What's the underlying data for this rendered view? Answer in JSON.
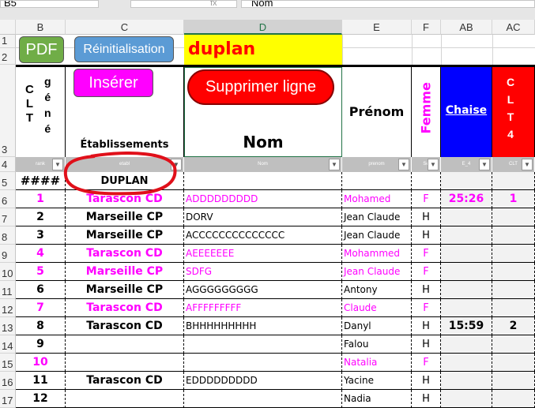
{
  "formula_bar": {
    "name_box": "B5",
    "fx": "fx",
    "formula": "Nom"
  },
  "columns": [
    "B",
    "C",
    "D",
    "E",
    "F",
    "AB",
    "AC"
  ],
  "row_numbers": [
    "1",
    "2",
    "3",
    "4",
    "5",
    "6",
    "7",
    "8",
    "9",
    "10",
    "11",
    "12",
    "13",
    "14",
    "15",
    "16",
    "17"
  ],
  "buttons": {
    "pdf": "PDF",
    "reset": "Réinitialisation",
    "insert": "Insérer",
    "delete": "Supprimer ligne"
  },
  "title_cell": "duplan",
  "headers": {
    "clt": [
      "C",
      "L",
      "T"
    ],
    "gene": [
      "g",
      "é",
      "n",
      "é"
    ],
    "etab": "Établissements",
    "nom": "Nom",
    "prenom": "Prénom",
    "femme": "Femme",
    "chaise": "Chaise",
    "clt4": [
      "C",
      "L",
      "T",
      "4"
    ]
  },
  "filters": [
    "rank",
    "etabl",
    "Nom",
    "prenom",
    "Se",
    "E_4",
    "CLT"
  ],
  "row5": {
    "rank": "####",
    "etab": "DUPLAN"
  },
  "colors": {
    "magenta": "#ff00ff",
    "blue": "#0000ff",
    "red": "#ff0000",
    "yellow": "#ffff00",
    "green": "#70ad47",
    "lightblue": "#5b9bd5"
  },
  "rows": [
    {
      "rank": "1",
      "etab": "Tarascon CD",
      "nom": "ADDDDDDDDD",
      "prenom": "Mohamed",
      "sexe": "F",
      "chaise": "25:26",
      "clt": "1",
      "f": true
    },
    {
      "rank": "2",
      "etab": "Marseille CP",
      "nom": "DORV",
      "prenom": "Jean Claude",
      "sexe": "H",
      "chaise": "",
      "clt": "",
      "f": false
    },
    {
      "rank": "3",
      "etab": "Marseille CP",
      "nom": "ACCCCCCCCCCCCCC",
      "prenom": "Jean Claude",
      "sexe": "H",
      "chaise": "",
      "clt": "",
      "f": false
    },
    {
      "rank": "4",
      "etab": "Tarascon CD",
      "nom": "AEEEEEEE",
      "prenom": "Mohammed",
      "sexe": "F",
      "chaise": "",
      "clt": "",
      "f": true
    },
    {
      "rank": "5",
      "etab": "Marseille CP",
      "nom": "SDFG",
      "prenom": "Jean Claude",
      "sexe": "F",
      "chaise": "",
      "clt": "",
      "f": true
    },
    {
      "rank": "6",
      "etab": "Marseille CP",
      "nom": "AGGGGGGGGG",
      "prenom": "Antony",
      "sexe": "H",
      "chaise": "",
      "clt": "",
      "f": false
    },
    {
      "rank": "7",
      "etab": "Tarascon CD",
      "nom": "AFFFFFFFFF",
      "prenom": "Claude",
      "sexe": "F",
      "chaise": "",
      "clt": "",
      "f": true
    },
    {
      "rank": "8",
      "etab": "Tarascon CD",
      "nom": "BHHHHHHHHH",
      "prenom": "Danyl",
      "sexe": "H",
      "chaise": "15:59",
      "clt": "2",
      "f": false
    },
    {
      "rank": "9",
      "etab": "",
      "nom": "",
      "prenom": "Falou",
      "sexe": "H",
      "chaise": "",
      "clt": "",
      "f": false
    },
    {
      "rank": "10",
      "etab": "",
      "nom": "",
      "prenom": "Natalia",
      "sexe": "F",
      "chaise": "",
      "clt": "",
      "f": true
    },
    {
      "rank": "11",
      "etab": "Tarascon CD",
      "nom": "EDDDDDDDDD",
      "prenom": "Yacine",
      "sexe": "H",
      "chaise": "",
      "clt": "",
      "f": false
    },
    {
      "rank": "12",
      "etab": "",
      "nom": "",
      "prenom": "Nadia",
      "sexe": "H",
      "chaise": "",
      "clt": "",
      "f": false
    }
  ]
}
